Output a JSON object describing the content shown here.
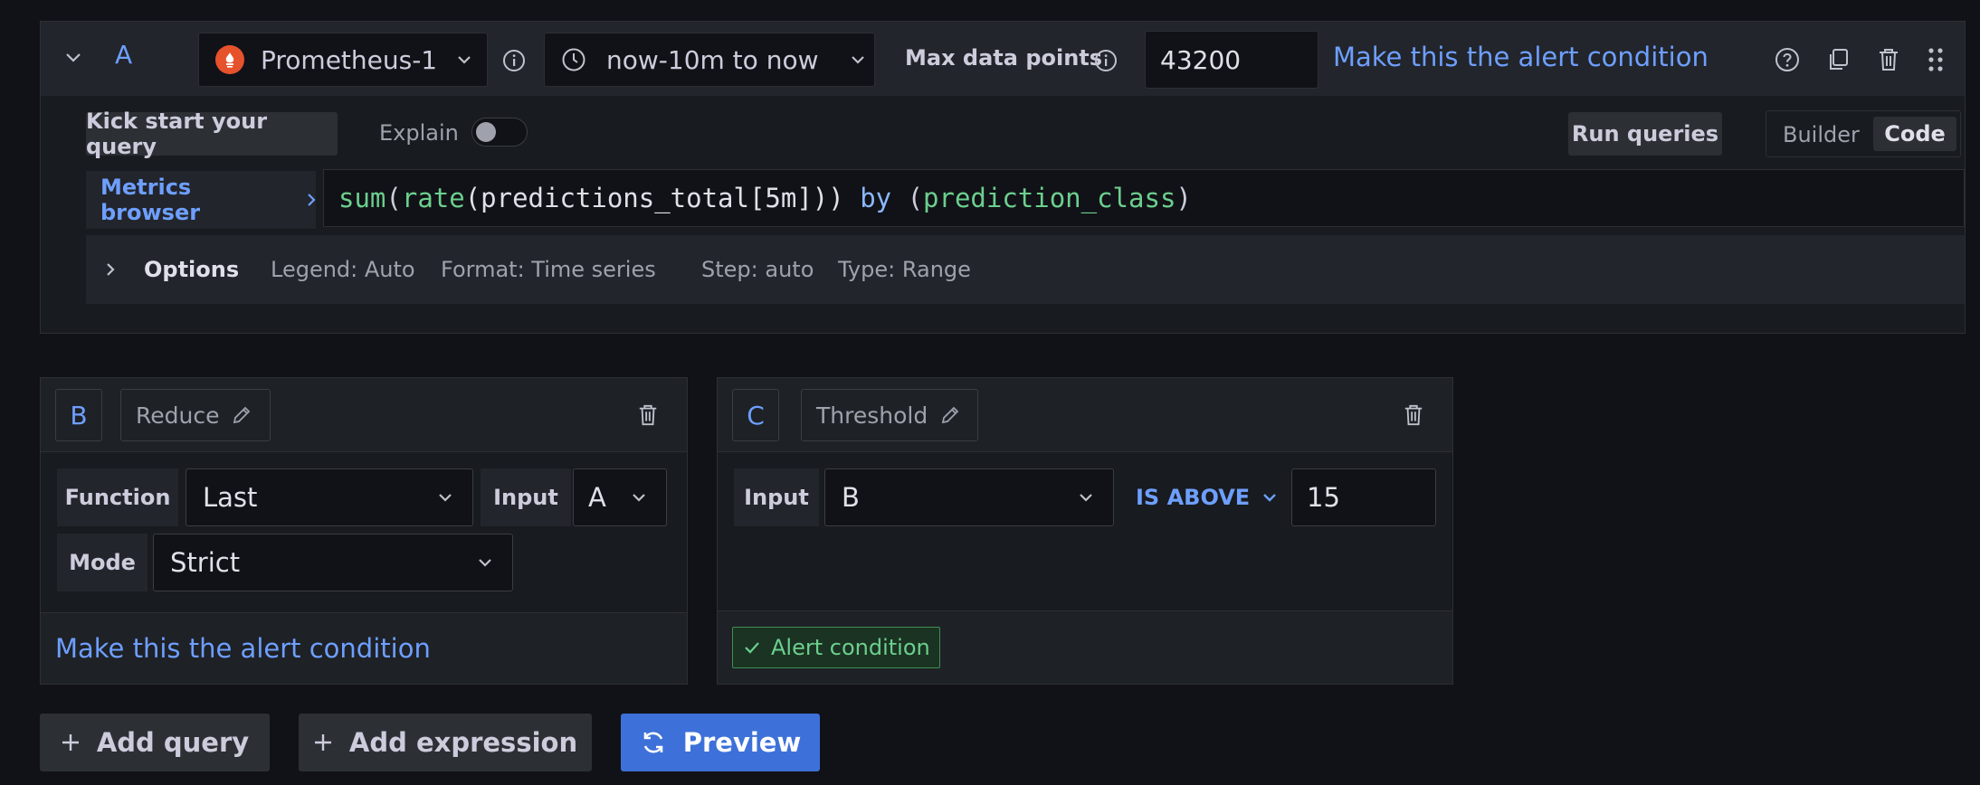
{
  "query_a": {
    "ref_id": "A",
    "datasource": "Prometheus-1",
    "time_range": "now-10m to now",
    "max_data_points_label": "Max data points",
    "max_data_points_value": "43200",
    "make_alert_condition": "Make this the alert condition",
    "kick_start": "Kick start your query",
    "explain": "Explain",
    "run_queries": "Run queries",
    "mode_builder": "Builder",
    "mode_code": "Code",
    "metrics_browser": "Metrics browser",
    "query_tokens": {
      "t1": "sum",
      "t2": "(",
      "t3": "rate",
      "t4": "(predictions_total[5m])) ",
      "t5": "by",
      "t6": " (",
      "t7": "prediction_class",
      "t8": ")"
    },
    "options": {
      "label": "Options",
      "legend": "Legend: Auto",
      "format": "Format: Time series",
      "step": "Step: auto",
      "type": "Type: Range"
    }
  },
  "expr_b": {
    "ref_id": "B",
    "name": "Reduce",
    "function_label": "Function",
    "function_value": "Last",
    "input_label": "Input",
    "input_value": "A",
    "mode_label": "Mode",
    "mode_value": "Strict",
    "make_alert_condition": "Make this the alert condition"
  },
  "expr_c": {
    "ref_id": "C",
    "name": "Threshold",
    "input_label": "Input",
    "input_value": "B",
    "operator": "IS ABOVE",
    "threshold_value": "15",
    "alert_condition_badge": "Alert condition"
  },
  "actions": {
    "add_query": "Add query",
    "add_expression": "Add expression",
    "preview": "Preview"
  },
  "colors": {
    "background": "#111217",
    "card": "#181b1f",
    "link": "#6e9fff",
    "primary": "#3d71d9",
    "success": "#6ccf8e",
    "prometheus": "#e6522c"
  }
}
